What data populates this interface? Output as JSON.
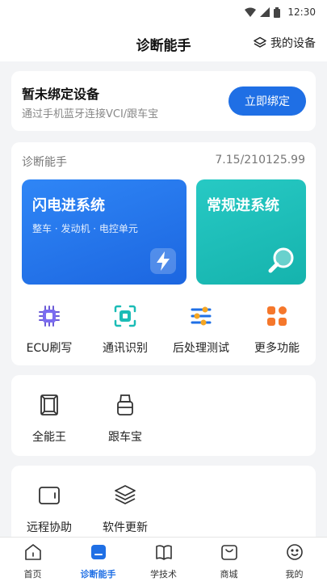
{
  "status_bar": {
    "time": "12:30"
  },
  "header": {
    "title": "诊断能手",
    "my_devices_label": "我的设备"
  },
  "bind_card": {
    "title": "暂未绑定设备",
    "subtitle": "通过手机蓝牙连接VCI/跟车宝",
    "bind_button_label": "立即绑定"
  },
  "diagnosis": {
    "section_title": "诊断能手",
    "version": "7.15/210125.99",
    "flash_system": {
      "title": "闪电进系统",
      "subtitle": "整车 · 发动机 · 电控单元"
    },
    "normal_system": {
      "title": "常规进系统"
    },
    "features": [
      {
        "label": "ECU刷写",
        "icon": "chip-icon"
      },
      {
        "label": "通讯识别",
        "icon": "scan-icon"
      },
      {
        "label": "后处理测试",
        "icon": "sliders-icon"
      },
      {
        "label": "更多功能",
        "icon": "grid-icon"
      }
    ]
  },
  "tools_group1": [
    {
      "label": "全能王",
      "icon": "device-icon"
    },
    {
      "label": "跟车宝",
      "icon": "dongle-icon"
    }
  ],
  "tools_group2": [
    {
      "label": "远程协助",
      "icon": "tablet-icon"
    },
    {
      "label": "软件更新",
      "icon": "layers-icon"
    }
  ],
  "tabbar": [
    {
      "label": "首页",
      "icon": "home-icon",
      "active": false
    },
    {
      "label": "诊断能手",
      "icon": "diagnosis-icon",
      "active": true
    },
    {
      "label": "学技术",
      "icon": "book-icon",
      "active": false
    },
    {
      "label": "商城",
      "icon": "shop-icon",
      "active": false
    },
    {
      "label": "我的",
      "icon": "user-icon",
      "active": false
    }
  ],
  "colors": {
    "accent": "#1f6fe5",
    "teal": "#1bbcb6",
    "orange": "#f5772b"
  }
}
